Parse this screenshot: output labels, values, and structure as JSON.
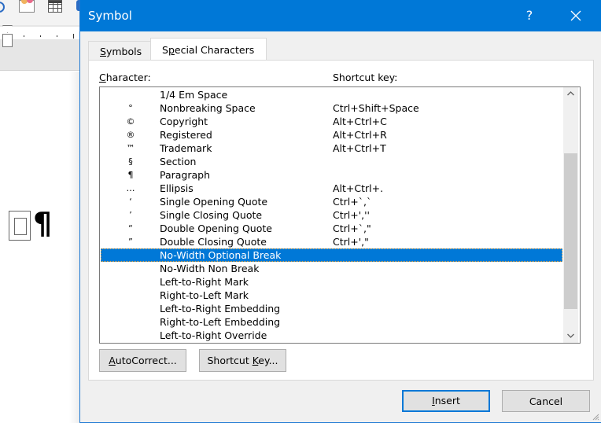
{
  "background_app": {
    "document_marks": {
      "optional_break_marker": "no-width-optional-break-marker",
      "paragraph_mark": "¶"
    }
  },
  "dialog": {
    "title": "Symbol",
    "help_label": "?",
    "tabs": [
      {
        "label": "Symbols",
        "mnemonic_index": 0,
        "active": false
      },
      {
        "label": "Special Characters",
        "mnemonic_index": 1,
        "active": true
      }
    ],
    "labels": {
      "character": "Character:",
      "shortcut_key": "Shortcut key:"
    },
    "characters": [
      {
        "symbol": "",
        "name": "1/4 Em Space",
        "shortcut": ""
      },
      {
        "symbol": "°",
        "name": "Nonbreaking Space",
        "shortcut": "Ctrl+Shift+Space"
      },
      {
        "symbol": "©",
        "name": "Copyright",
        "shortcut": "Alt+Ctrl+C"
      },
      {
        "symbol": "®",
        "name": "Registered",
        "shortcut": "Alt+Ctrl+R"
      },
      {
        "symbol": "™",
        "name": "Trademark",
        "shortcut": "Alt+Ctrl+T"
      },
      {
        "symbol": "§",
        "name": "Section",
        "shortcut": ""
      },
      {
        "symbol": "¶",
        "name": "Paragraph",
        "shortcut": ""
      },
      {
        "symbol": "…",
        "name": "Ellipsis",
        "shortcut": "Alt+Ctrl+."
      },
      {
        "symbol": "‘",
        "name": "Single Opening Quote",
        "shortcut": "Ctrl+`,`"
      },
      {
        "symbol": "’",
        "name": "Single Closing Quote",
        "shortcut": "Ctrl+',''"
      },
      {
        "symbol": "“",
        "name": "Double Opening Quote",
        "shortcut": "Ctrl+`,\""
      },
      {
        "symbol": "”",
        "name": "Double Closing Quote",
        "shortcut": "Ctrl+',\""
      },
      {
        "symbol": "",
        "name": "No-Width Optional Break",
        "shortcut": "",
        "selected": true
      },
      {
        "symbol": "",
        "name": "No-Width Non Break",
        "shortcut": ""
      },
      {
        "symbol": "",
        "name": "Left-to-Right Mark",
        "shortcut": ""
      },
      {
        "symbol": "",
        "name": "Right-to-Left Mark",
        "shortcut": ""
      },
      {
        "symbol": "",
        "name": "Left-to-Right Embedding",
        "shortcut": ""
      },
      {
        "symbol": "",
        "name": "Right-to-Left Embedding",
        "shortcut": ""
      },
      {
        "symbol": "",
        "name": "Left-to-Right Override",
        "shortcut": ""
      }
    ],
    "buttons": {
      "autocorrect": "AutoCorrect...",
      "shortcut_key": "Shortcut Key...",
      "insert": "Insert",
      "cancel": "Cancel"
    },
    "colors": {
      "titlebar": "#0078d7",
      "selection": "#0078d7",
      "dialog_bg": "#f0f0f0"
    }
  }
}
